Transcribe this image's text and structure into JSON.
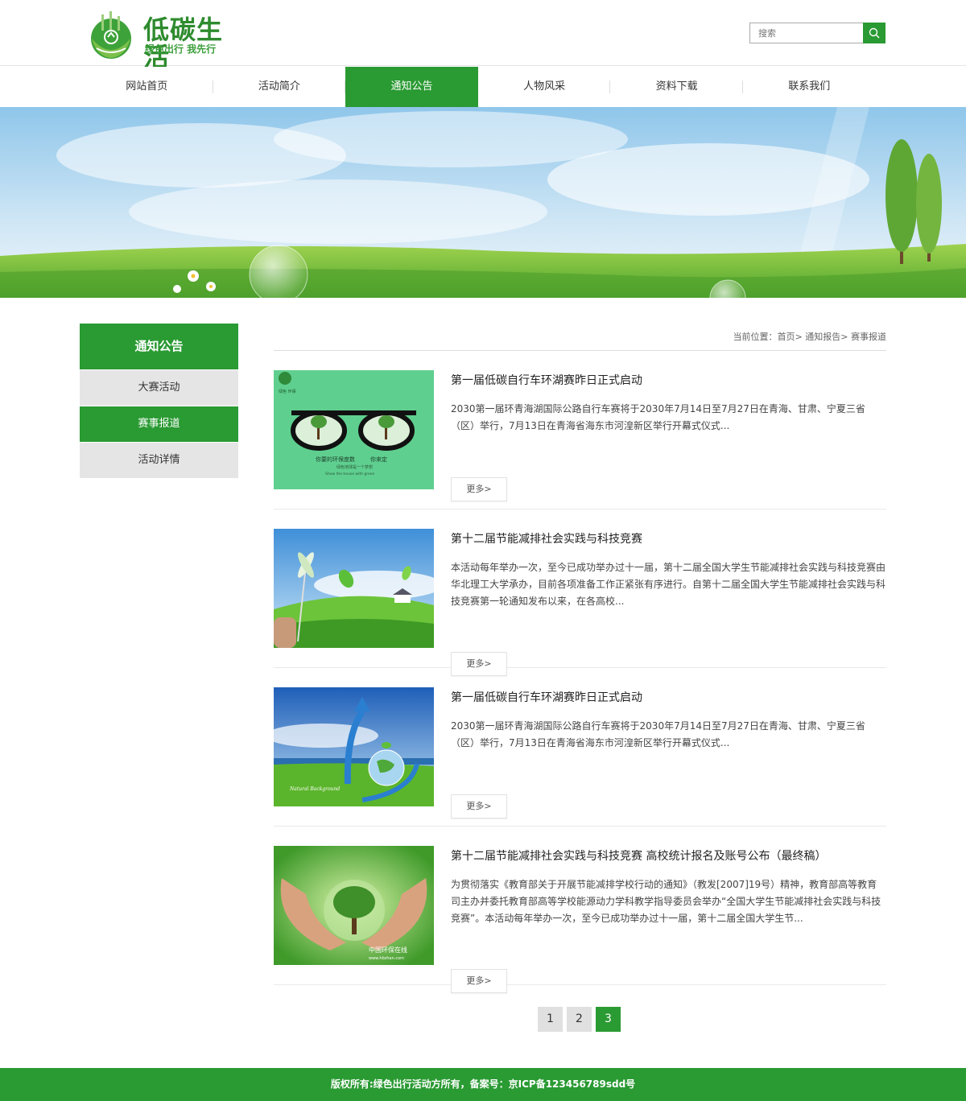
{
  "brand": {
    "title": "低碳生活",
    "slogan": "绿色出行 我先行"
  },
  "search": {
    "placeholder": "搜索",
    "value": ""
  },
  "nav": {
    "items": [
      {
        "label": "网站首页"
      },
      {
        "label": "活动简介"
      },
      {
        "label": "通知公告"
      },
      {
        "label": "人物风采"
      },
      {
        "label": "资料下载"
      },
      {
        "label": "联系我们"
      }
    ],
    "active_index": 2
  },
  "sidebar": {
    "title": "通知公告",
    "items": [
      {
        "label": "大赛活动"
      },
      {
        "label": "赛事报道"
      },
      {
        "label": "活动详情"
      }
    ],
    "active_index": 1
  },
  "breadcrumb": {
    "prefix": "当前位置：",
    "items": [
      "首页",
      "通知报告",
      "赛事报道"
    ],
    "separator": "> "
  },
  "articles": [
    {
      "title": "第一届低碳自行车环湖赛昨日正式启动",
      "desc": "2030第一届环青海湖国际公路自行车赛将于2030年7月14日至7月27日在青海、甘肃、宁夏三省（区）举行，7月13日在青海省海东市河湟新区举行开幕式仪式...",
      "more": "更多>",
      "thumb_text": [
        "绿色 环保",
        "你要的环保度数",
        "你来定",
        "绿色地球是一个梦想",
        "Show the house with green"
      ]
    },
    {
      "title": "第十二届节能减排社会实践与科技竞赛",
      "desc": "本活动每年举办一次，至今已成功举办过十一届，第十二届全国大学生节能减排社会实践与科技竞赛由华北理工大学承办，目前各项准备工作正紧张有序进行。自第十二届全国大学生节能减排社会实践与科技竞赛第一轮通知发布以来，在各高校...",
      "more": "更多>"
    },
    {
      "title": "第一届低碳自行车环湖赛昨日正式启动",
      "desc": "2030第一届环青海湖国际公路自行车赛将于2030年7月14日至7月27日在青海、甘肃、宁夏三省（区）举行，7月13日在青海省海东市河湟新区举行开幕式仪式...",
      "more": "更多>",
      "thumb_text": [
        "Natural Background"
      ]
    },
    {
      "title": "第十二届节能减排社会实践与科技竞赛 高校统计报名及账号公布（最终稿）",
      "desc": "为贯彻落实《教育部关于开展节能减排学校行动的通知》（教发[2007]19号）精神，教育部高等教育司主办并委托教育部高等学校能源动力学科教学指导委员会举办“全国大学生节能减排社会实践与科技竞赛”。本活动每年举办一次，至今已成功举办过十一届，第十二届全国大学生节...",
      "more": "更多>",
      "thumb_text": [
        "中国环保在线",
        "www.hbzhan.com"
      ]
    }
  ],
  "pagination": {
    "pages": [
      "1",
      "2",
      "3"
    ],
    "current_index": 2
  },
  "footer": {
    "text": "版权所有:绿色出行活动方所有，备案号：京ICP备123456789sdd号"
  },
  "colors": {
    "primary_green": "#2a9a33",
    "sidebar_gray": "#e5e5e5"
  }
}
